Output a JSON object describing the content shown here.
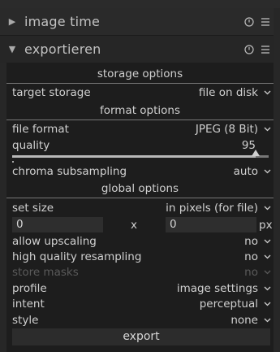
{
  "collapsed_module": {
    "title": "image time",
    "arrow": "▶"
  },
  "expanded_module": {
    "title": "exportieren",
    "arrow": "▼"
  },
  "sections": {
    "storage": "storage options",
    "format": "format options",
    "global": "global options"
  },
  "storage": {
    "label": "target storage",
    "value": "file on disk"
  },
  "format": {
    "file_format_label": "file format",
    "file_format_value": "JPEG (8 Bit)",
    "quality_label": "quality",
    "quality_value": "95",
    "quality_fraction": 0.95,
    "chroma_label": "chroma subsampling",
    "chroma_value": "auto"
  },
  "global": {
    "set_size_label": "set size",
    "set_size_value": "in pixels (for file)",
    "width_value": "0",
    "height_value": "0",
    "x_sep": "x",
    "unit": "px",
    "upscaling_label": "allow upscaling",
    "upscaling_value": "no",
    "hq_label": "high quality resampling",
    "hq_value": "no",
    "masks_label": "store masks",
    "masks_value": "no",
    "profile_label": "profile",
    "profile_value": "image settings",
    "intent_label": "intent",
    "intent_value": "perceptual",
    "style_label": "style",
    "style_value": "none"
  },
  "export_label": "export",
  "icons": {
    "reset": "reset-icon",
    "presets": "presets-menu-icon",
    "dropdown": "chevron-down-icon"
  },
  "colors": {
    "panel_bg": "#1d1d1d",
    "header_bg": "#2a2a2a",
    "text": "#d0d0d0",
    "disabled_text": "#5a5a5a"
  }
}
